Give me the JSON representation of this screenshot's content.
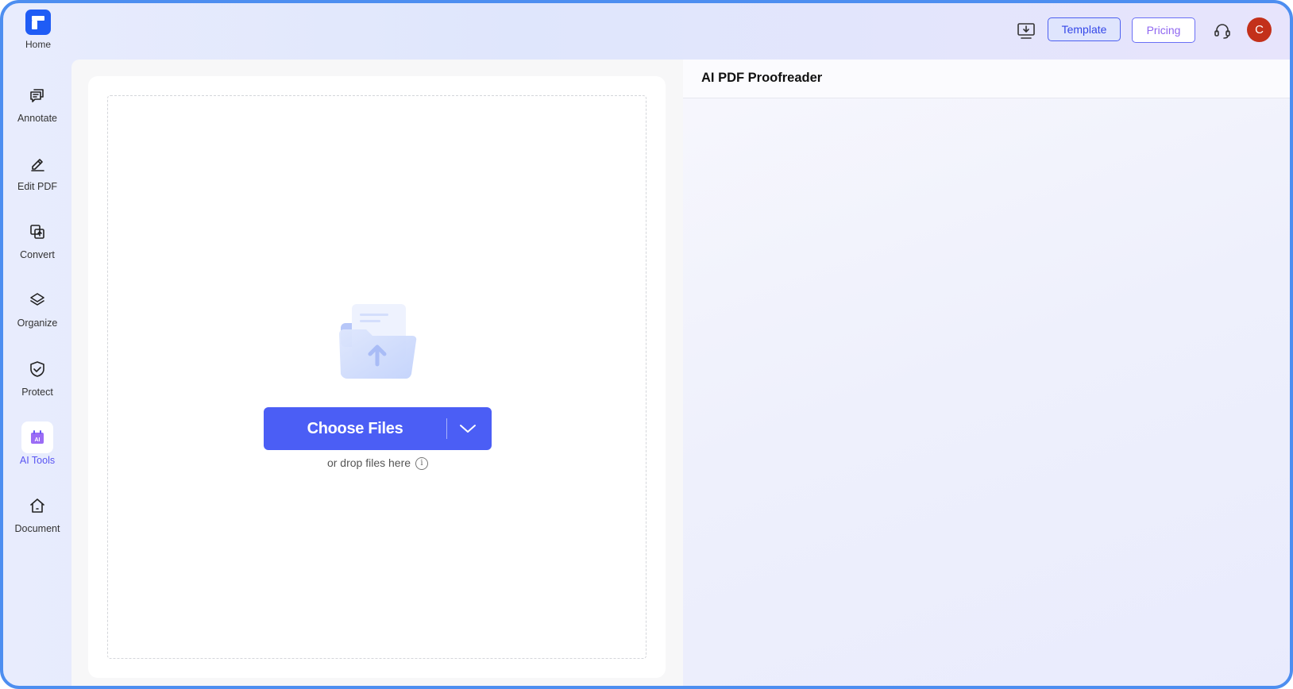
{
  "header": {
    "home_label": "Home",
    "template_label": "Template",
    "pricing_label": "Pricing",
    "avatar_initial": "C"
  },
  "sidebar": {
    "items": [
      {
        "label": "Annotate",
        "icon": "annotate-icon"
      },
      {
        "label": "Edit PDF",
        "icon": "edit-pdf-icon"
      },
      {
        "label": "Convert",
        "icon": "convert-icon"
      },
      {
        "label": "Organize",
        "icon": "organize-icon"
      },
      {
        "label": "Protect",
        "icon": "protect-icon"
      },
      {
        "label": "AI Tools",
        "icon": "ai-tools-icon",
        "active": true
      },
      {
        "label": "Document",
        "icon": "document-icon"
      }
    ]
  },
  "upload": {
    "choose_label": "Choose Files",
    "drop_hint": "or drop files here"
  },
  "panel": {
    "title": "AI PDF Proofreader"
  },
  "colors": {
    "primary": "#4b5ef5",
    "logo": "#1f5cf5",
    "avatar": "#c3301a",
    "active_text": "#5a55f2",
    "frame_border": "#4d8ef0"
  }
}
